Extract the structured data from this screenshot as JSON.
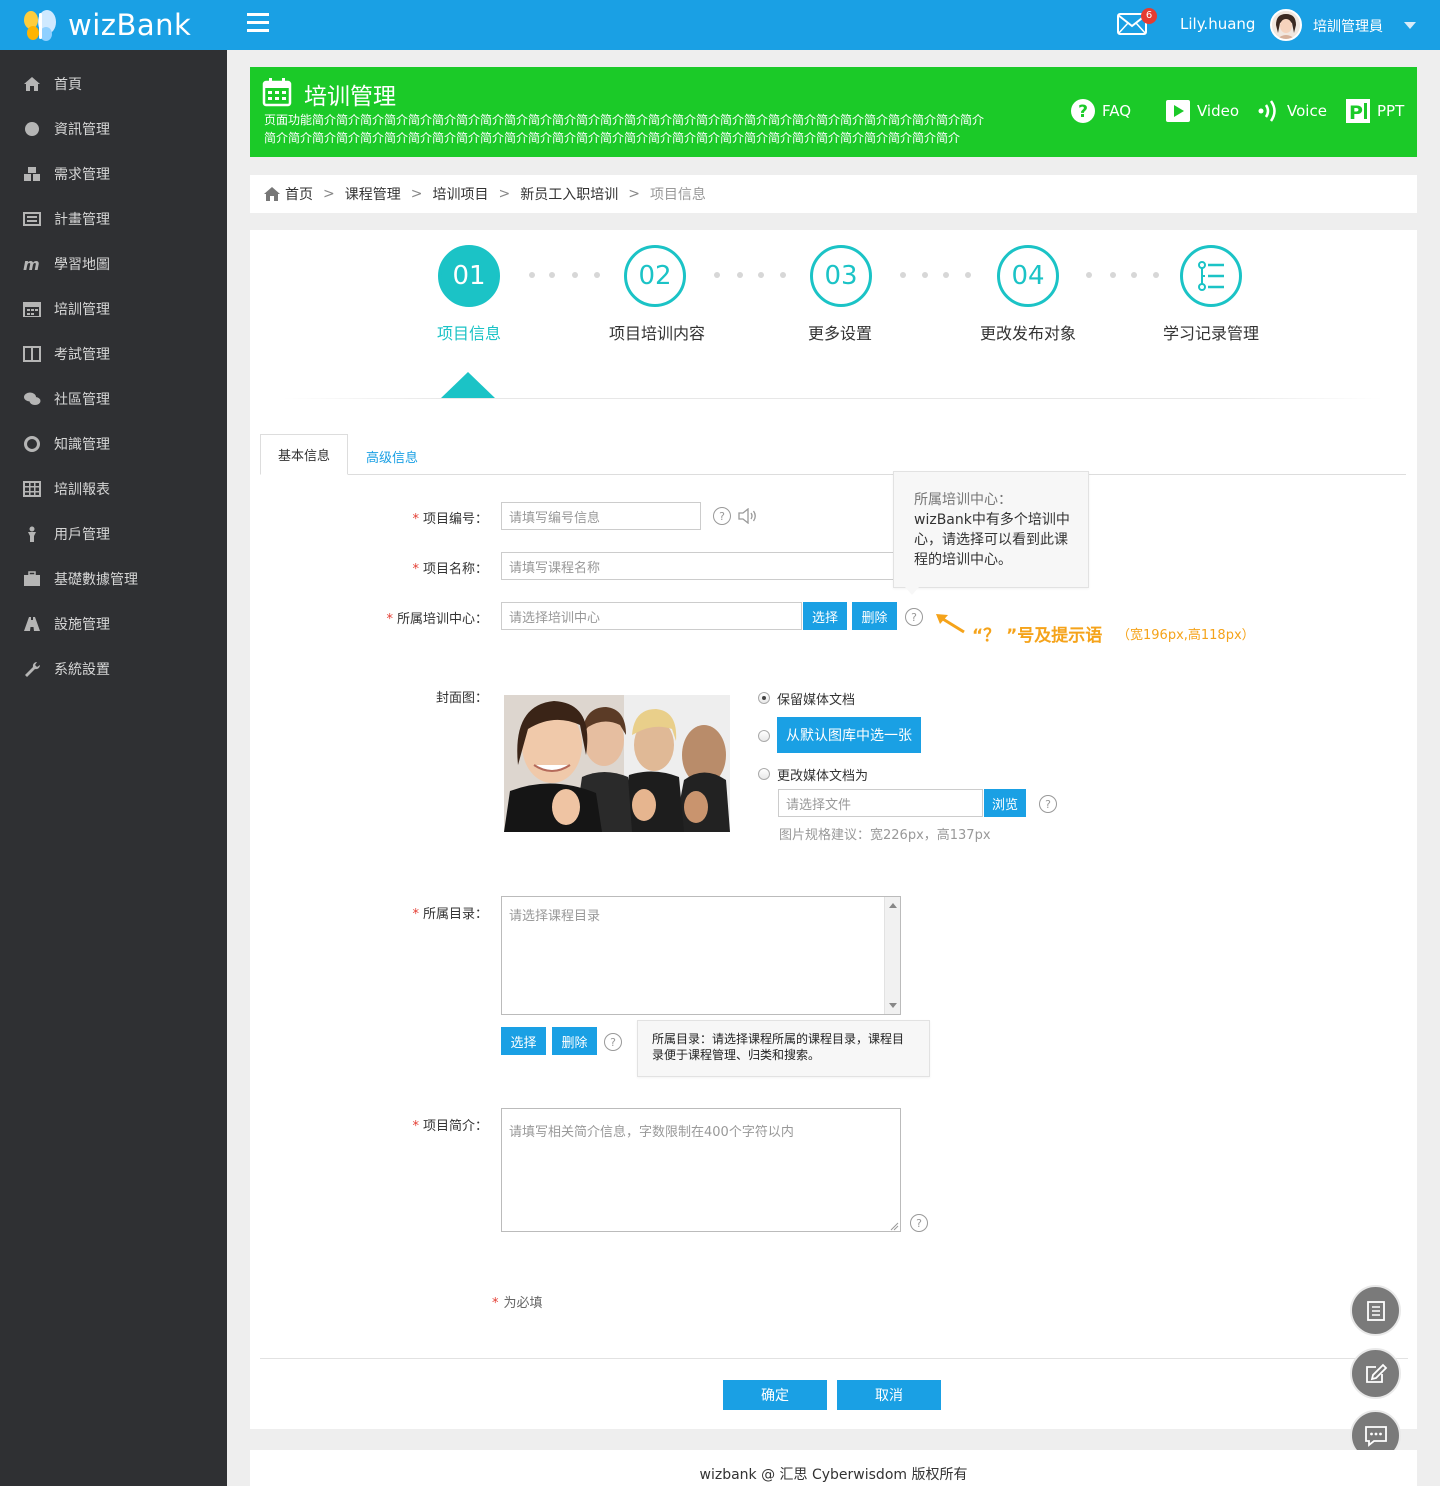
{
  "app": {
    "logo_text": "wizBank"
  },
  "sidebar": {
    "items": [
      {
        "label": "首頁",
        "icon": "home-icon"
      },
      {
        "label": "資訊管理",
        "icon": "globe-icon"
      },
      {
        "label": "需求管理",
        "icon": "cubes-icon"
      },
      {
        "label": "計畫管理",
        "icon": "list-icon"
      },
      {
        "label": "學習地圖",
        "icon": "m-icon"
      },
      {
        "label": "培訓管理",
        "icon": "calendar-icon"
      },
      {
        "label": "考試管理",
        "icon": "columns-icon"
      },
      {
        "label": "社區管理",
        "icon": "comments-icon"
      },
      {
        "label": "知識管理",
        "icon": "lifebuoy-icon"
      },
      {
        "label": "培訓報表",
        "icon": "table-icon"
      },
      {
        "label": "用戶管理",
        "icon": "user-icon"
      },
      {
        "label": "基礎數據管理",
        "icon": "briefcase-icon"
      },
      {
        "label": "設施管理",
        "icon": "road-icon"
      },
      {
        "label": "系統設置",
        "icon": "wrench-icon"
      }
    ]
  },
  "topbar": {
    "mail_count": "6",
    "username": "Lily.huang",
    "role": "培訓管理員"
  },
  "banner": {
    "title": "培训管理",
    "description": "页面功能简介简介简介简介简介简介简介简介简介简介简介简介简介简介简介简介简介简介简介简介简介简介简介简介简介简介简介简介简介简介简介简介简介简介简介简介简介简介简介简介简介简介简介简介简介简介简介简介简介简介简介简介简介简介简介简介简介",
    "links": {
      "faq": "FAQ",
      "video": "Video",
      "voice": "Voice",
      "ppt": "PPT"
    }
  },
  "breadcrumb": {
    "home": "首页",
    "c1": "课程管理",
    "c2": "培训项目",
    "c3": "新员工入职培训",
    "current": "项目信息",
    "sep": ">"
  },
  "steps": [
    {
      "num": "01",
      "label": "项目信息"
    },
    {
      "num": "02",
      "label": "项目培训内容"
    },
    {
      "num": "03",
      "label": "更多设置"
    },
    {
      "num": "04",
      "label": "更改发布对象"
    },
    {
      "num": "",
      "label": "学习记录管理"
    }
  ],
  "tabs": {
    "basic": "基本信息",
    "advanced": "高级信息"
  },
  "form": {
    "code_label": "项目编号：",
    "code_placeholder": "请填写编号信息",
    "name_label": "项目名称：",
    "name_placeholder": "请填写课程名称",
    "center_label": "所属培训中心：",
    "center_placeholder": "请选择培训中心",
    "select_btn": "选择",
    "delete_btn": "删除",
    "center_tip_title": "所属培训中心：",
    "center_tip_body": "wizBank中有多个培训中心，请选择可以看到此课程的培训中心。",
    "annotation": "“？ ”号及提示语",
    "annotation_size": "（宽196px,高118px）",
    "cover_label": "封面图：",
    "cover_opt1": "保留媒体文档",
    "cover_opt2": "从默认图库中选一张",
    "cover_opt3": "更改媒体文档为",
    "file_placeholder": "请选择文件",
    "browse_btn": "浏览",
    "cover_hint": "图片规格建议：宽226px，高137px",
    "catalog_label": "所属目录：",
    "catalog_placeholder": "请选择课程目录",
    "catalog_tip": "所属目录：请选择课程所属的课程目录，课程目录便于课程管理、归类和搜索。",
    "intro_label": "项目简介：",
    "intro_placeholder": "请填写相关简介信息，字数限制在400个字符以内",
    "required_note": "为必填",
    "required_mark": "*"
  },
  "actions": {
    "confirm": "确定",
    "cancel": "取消"
  },
  "footer": {
    "text": "wizbank @ 汇思 Cyberwisdom 版权所有"
  },
  "colors": {
    "primary": "#1aa0e4",
    "banner": "#1bca28",
    "step": "#1bc3c6",
    "sidebar": "#2f3033",
    "annotation": "#f5a31a",
    "required": "#e43c31"
  }
}
